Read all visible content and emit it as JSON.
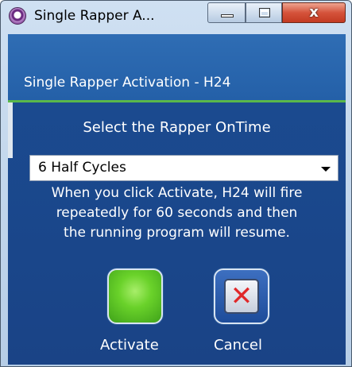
{
  "window": {
    "title": "Single Rapper A...",
    "close_symbol": "x"
  },
  "dialog": {
    "header_title": "Single Rapper Activation - H24",
    "select_label": "Select the Rapper OnTime",
    "dropdown_value": "6 Half Cycles",
    "description_lines": [
      "When you click Activate, H24 will fire",
      "repeatedly for 60 seconds and then",
      "the running program will resume."
    ],
    "activate_label": "Activate",
    "cancel_label": "Cancel"
  },
  "icons": {
    "app": "app-icon",
    "minimize": "minimize-icon",
    "maximize": "maximize-icon",
    "close": "close-icon",
    "dropdown": "chevron-down-icon",
    "activate": "green-activate-icon",
    "cancel": "red-x-cancel-icon"
  },
  "colors": {
    "dialog_background": "#1b4c92",
    "header_background": "#2f6db4",
    "accent_line": "#5ab84a",
    "activate_green": "#6ad22a",
    "cancel_red": "#e0282a",
    "close_button": "#d5533b"
  }
}
